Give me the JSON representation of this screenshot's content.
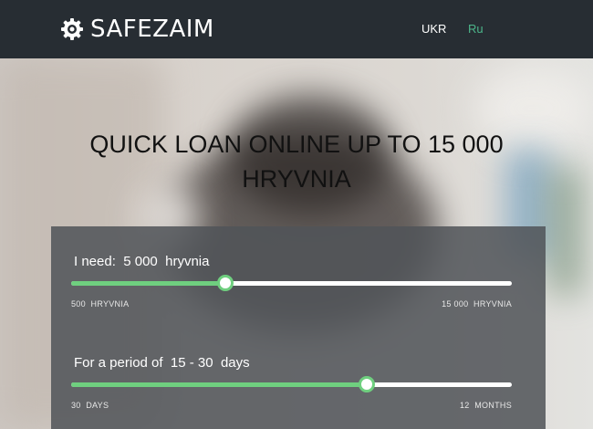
{
  "header": {
    "logo_text": "SAFEZAIM",
    "languages": [
      {
        "label": "UKR",
        "active": false
      },
      {
        "label": "Ru",
        "active": true
      }
    ]
  },
  "hero": {
    "title_line1": "QUICK LOAN ONLINE UP TO 15 000",
    "title_line2": "HRYVNIA"
  },
  "calculator": {
    "amount": {
      "prefix": "I need:",
      "value": "5 000",
      "unit": "hryvnia",
      "min_label": "500  HRYVNIA",
      "max_label": "15 000  HRYVNIA",
      "fill_fraction": 0.35
    },
    "period": {
      "prefix": "For a period of",
      "value": "15 - 30",
      "unit": "days",
      "min_label": "30  DAYS",
      "max_label": "12  MONTHS",
      "fill_fraction": 0.67
    }
  },
  "colors": {
    "header_bg": "#272d33",
    "accent": "#6fcf7f",
    "lang_active": "#4cb58a",
    "panel_bg": "#505458"
  }
}
